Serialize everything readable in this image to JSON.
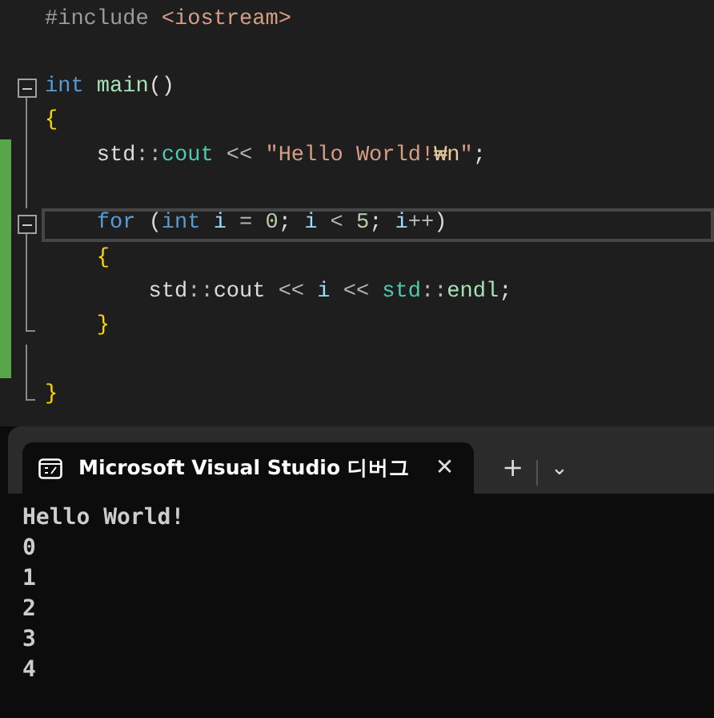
{
  "editor": {
    "lines": [
      {
        "kind": "plain",
        "changed": false,
        "tokens": [
          {
            "text": "#include ",
            "kind": "preproc"
          },
          {
            "text": "<iostream>",
            "kind": "string"
          }
        ]
      },
      {
        "kind": "plain",
        "changed": false
      },
      {
        "kind": "fold-start",
        "changed": false,
        "tokens": [
          {
            "text": "int ",
            "kind": "keyword"
          },
          {
            "text": "main",
            "kind": "function"
          },
          {
            "text": "()",
            "kind": "plain"
          }
        ]
      },
      {
        "kind": "fold-inside",
        "changed": false,
        "tokens": [
          {
            "text": "{",
            "kind": "brace"
          }
        ]
      },
      {
        "kind": "fold-inside",
        "changed": true,
        "tokens": [
          {
            "text": "    std",
            "kind": "plain"
          },
          {
            "text": "::",
            "kind": "operator"
          },
          {
            "text": "cout",
            "kind": "type"
          },
          {
            "text": " << ",
            "kind": "operator"
          },
          {
            "text": "\"Hello World!",
            "kind": "string"
          },
          {
            "text": "₩n",
            "kind": "escape"
          },
          {
            "text": "\"",
            "kind": "string"
          },
          {
            "text": ";",
            "kind": "plain"
          }
        ]
      },
      {
        "kind": "fold-inside",
        "changed": true
      },
      {
        "kind": "fold-start",
        "changed": true,
        "current": true,
        "tokens": [
          {
            "text": "    for",
            "kind": "keyword"
          },
          {
            "text": " (",
            "kind": "plain"
          },
          {
            "text": "int ",
            "kind": "keyword"
          },
          {
            "text": "i",
            "kind": "variable"
          },
          {
            "text": " = ",
            "kind": "operator"
          },
          {
            "text": "0",
            "kind": "number"
          },
          {
            "text": "; ",
            "kind": "plain"
          },
          {
            "text": "i",
            "kind": "variable"
          },
          {
            "text": " < ",
            "kind": "operator"
          },
          {
            "text": "5",
            "kind": "number"
          },
          {
            "text": "; ",
            "kind": "plain"
          },
          {
            "text": "i",
            "kind": "variable"
          },
          {
            "text": "++",
            "kind": "operator"
          },
          {
            "text": ")",
            "kind": "plain"
          }
        ]
      },
      {
        "kind": "fold-inside",
        "changed": true,
        "tokens": [
          {
            "text": "    {",
            "kind": "brace"
          }
        ]
      },
      {
        "kind": "fold-inside",
        "changed": true,
        "tokens": [
          {
            "text": "        std",
            "kind": "plain"
          },
          {
            "text": "::",
            "kind": "operator"
          },
          {
            "text": "cout",
            "kind": "plain"
          },
          {
            "text": " << ",
            "kind": "operator"
          },
          {
            "text": "i",
            "kind": "variable"
          },
          {
            "text": " << ",
            "kind": "operator"
          },
          {
            "text": "std",
            "kind": "type"
          },
          {
            "text": "::",
            "kind": "operator"
          },
          {
            "text": "endl",
            "kind": "function"
          },
          {
            "text": ";",
            "kind": "plain"
          }
        ]
      },
      {
        "kind": "fold-end",
        "changed": true,
        "tokens": [
          {
            "text": "    }",
            "kind": "brace"
          }
        ]
      },
      {
        "kind": "fold-inside",
        "changed": true
      },
      {
        "kind": "fold-end",
        "changed": false,
        "tokens": [
          {
            "text": "}",
            "kind": "brace"
          }
        ]
      }
    ]
  },
  "terminal": {
    "tab": {
      "title": "Microsoft Visual Studio 디버그",
      "selected": true,
      "close": "✕"
    },
    "new_tab": "+",
    "dropdown": "⌄",
    "output": [
      "Hello World!",
      "0",
      "1",
      "2",
      "3",
      "4"
    ]
  }
}
